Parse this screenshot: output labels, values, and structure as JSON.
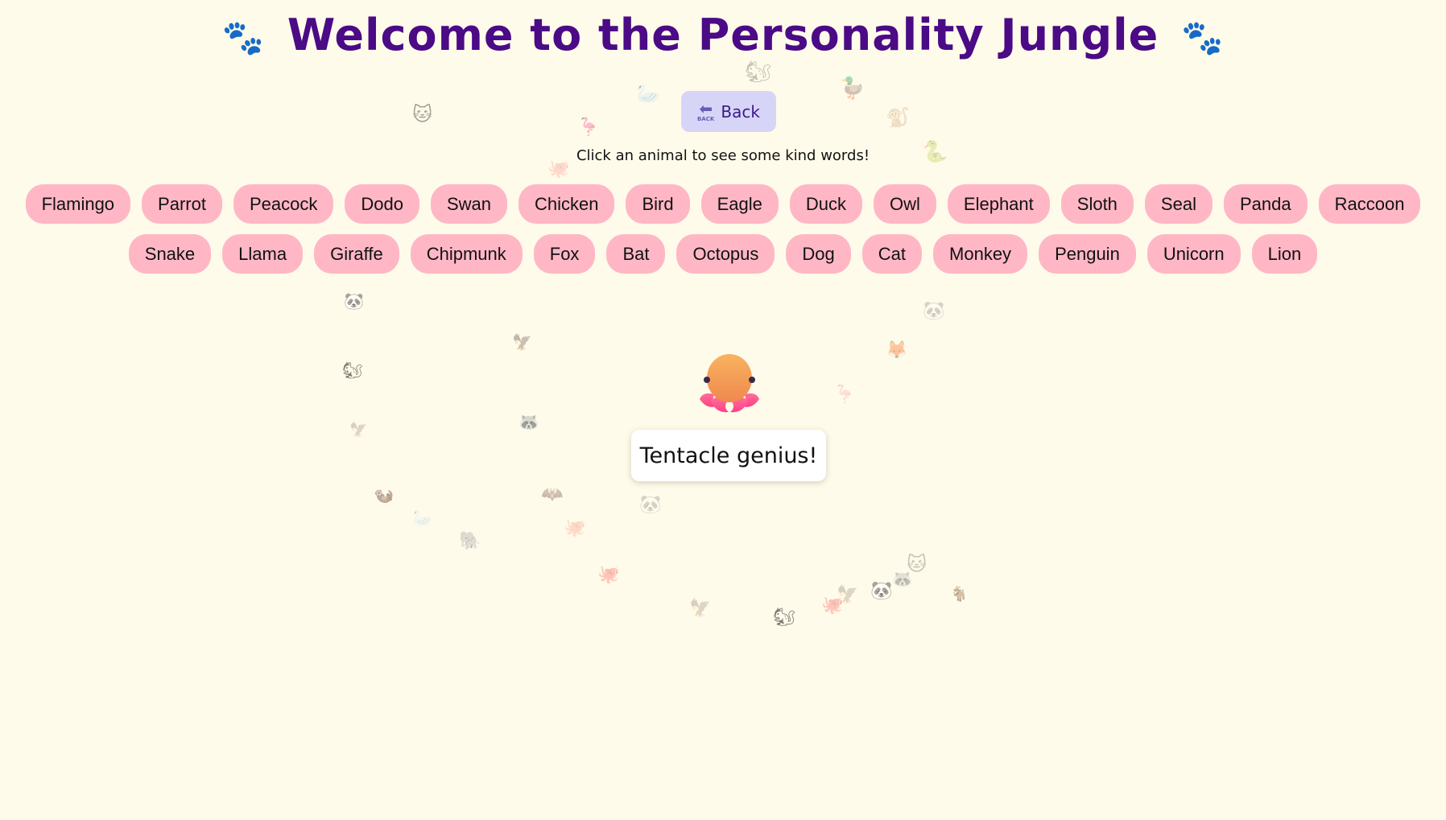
{
  "header": {
    "title": "Welcome to the Personality Jungle",
    "left_icon": "paw-prints-icon",
    "right_icon": "paw-prints-icon",
    "paw_glyph": "🐾"
  },
  "back_button": {
    "label": "Back",
    "icon": "back-arrow-icon",
    "icon_glyph": "⬅",
    "icon_caption": "BACK"
  },
  "hint": "Click an animal to see some kind words!",
  "animals_row1": [
    "Flamingo",
    "Parrot",
    "Peacock",
    "Dodo",
    "Swan",
    "Chicken",
    "Bird",
    "Eagle",
    "Duck",
    "Owl",
    "Elephant",
    "Sloth",
    "Seal",
    "Panda",
    "Raccoon"
  ],
  "animals_row2": [
    "Snake",
    "Llama",
    "Giraffe",
    "Chipmunk",
    "Fox",
    "Bat",
    "Octopus",
    "Dog",
    "Cat",
    "Monkey",
    "Penguin",
    "Unicorn",
    "Lion"
  ],
  "selected": {
    "animal": "Octopus",
    "icon": "octopus-icon",
    "message": "Tentacle genius!"
  },
  "background_emojis": [
    "🐱",
    "🐿",
    "🦢",
    "🦆",
    "🐒",
    "🦩",
    "🐍",
    "🐙",
    "🦉",
    "🐧",
    "🐼",
    "🐼",
    "🦊",
    "🦩",
    "🐿",
    "🦅",
    "🦅",
    "🦝",
    "🦇",
    "🐼",
    "🦦",
    "🦢",
    "🐙",
    "🐘",
    "🐙",
    "🦅",
    "🐿",
    "🐙",
    "🦅",
    "🐼",
    "🦝",
    "🐱",
    "🐐"
  ],
  "colors": {
    "background": "#fffbea",
    "title": "#4b0a86",
    "button": "#ffb7c6",
    "back_button": "#d7d5f7"
  }
}
